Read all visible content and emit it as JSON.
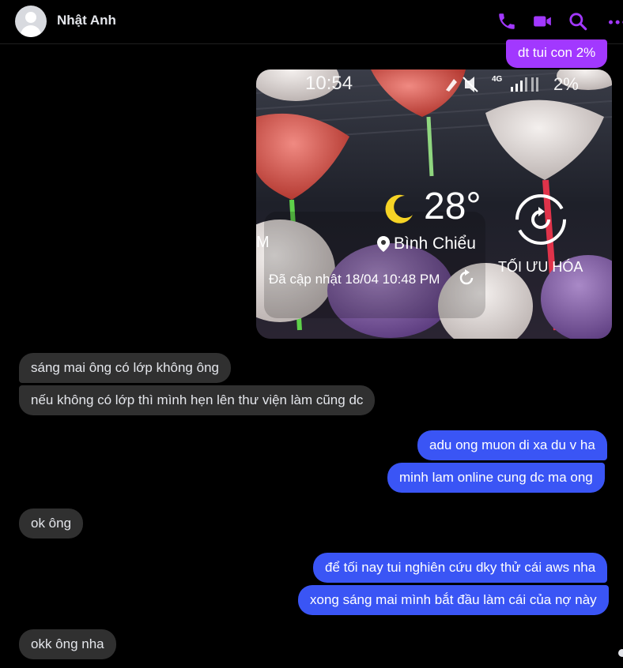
{
  "header": {
    "contact_name": "Nhật Anh",
    "accent": "#a238ff"
  },
  "messages": {
    "m0": "dt tui con 2%",
    "m1": "sáng mai ông có lớp không ông",
    "m2": "nếu không có lớp thì mình hẹn lên thư viện làm cũng dc",
    "m3": "adu ong muon di xa du v ha",
    "m4": "minh lam online cung dc ma ong",
    "m5": "ok ông",
    "m6": "để tối nay tui nghiên cứu dky thử cái aws nha",
    "m7": "xong sáng mai mình bắt đầu làm cái của nợ này",
    "m8": "okk ông nha"
  },
  "photo": {
    "time": "10:54",
    "network": "4G",
    "battery": "2%",
    "temperature": "28°",
    "location": "Bình Chiểu",
    "updated": "Đã cập nhật 18/04 10:48 PM",
    "optimize": "TỐI ƯU HÓA",
    "edge_letter": "M"
  },
  "colors": {
    "incoming": "#303030",
    "outgoing": "#3a55f5",
    "outgoing_alt": "#a238ff"
  },
  "icons": [
    "phone-icon",
    "video-icon",
    "search-icon",
    "more-icon",
    "moon-icon",
    "location-pin-icon",
    "refresh-icon",
    "optimize-icon"
  ]
}
